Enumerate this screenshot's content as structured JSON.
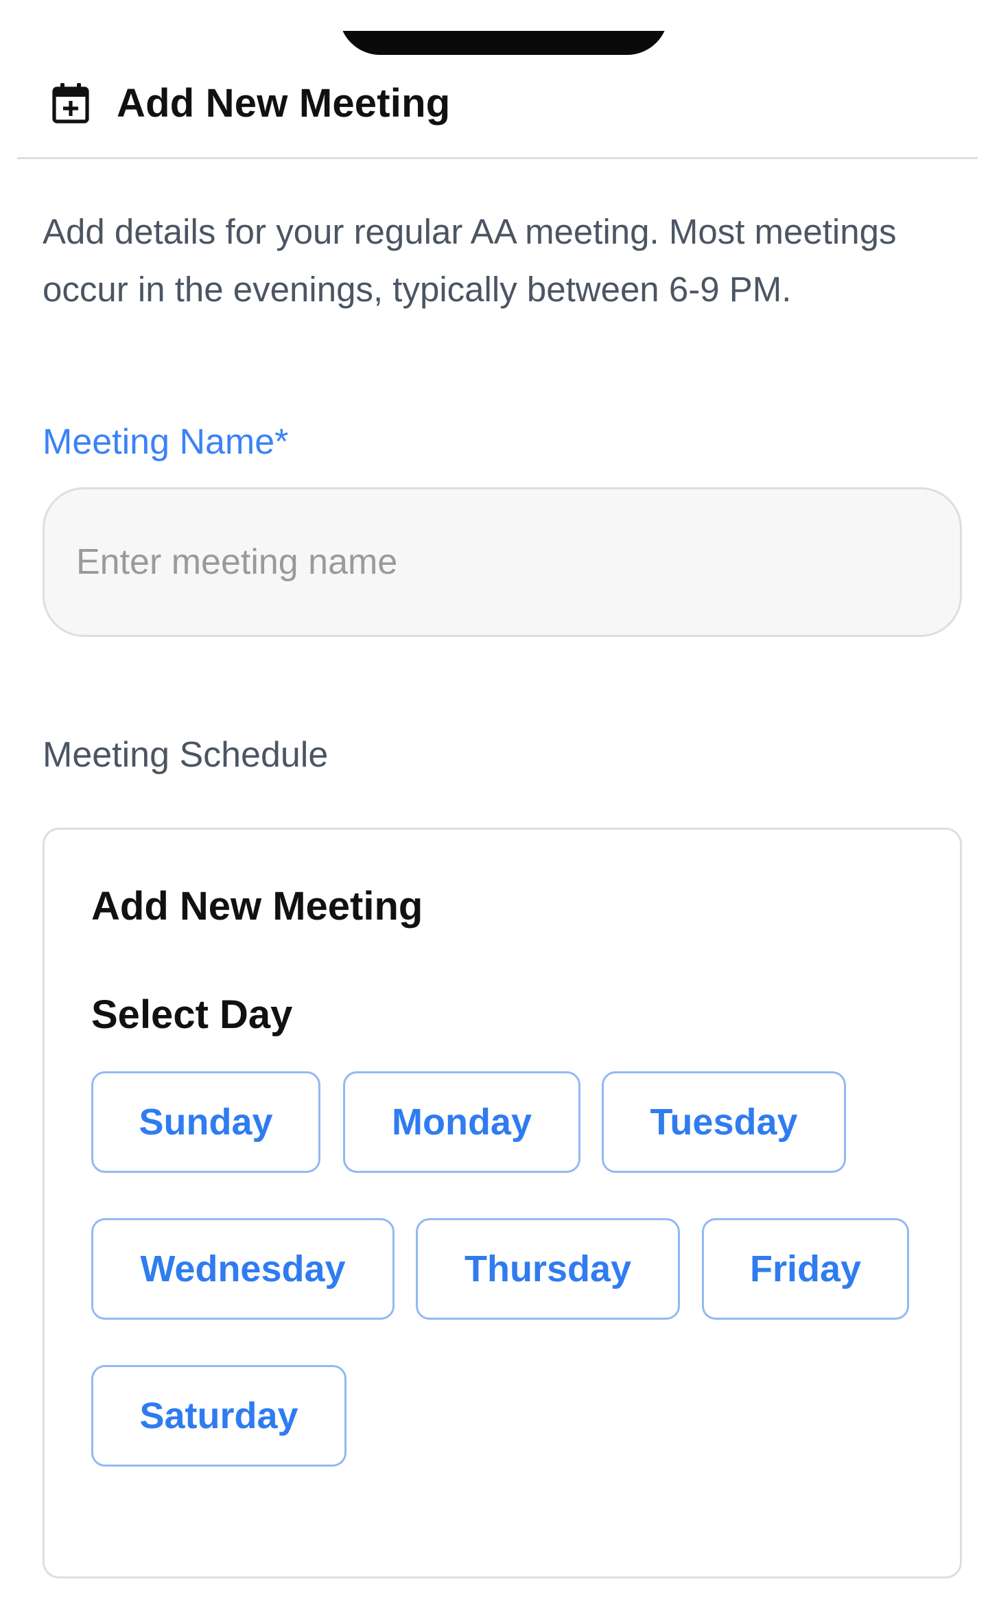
{
  "header": {
    "icon": "calendar-plus-icon",
    "title": "Add New Meeting"
  },
  "description": "Add details for your regular AA meeting. Most meetings occur in the evenings, typically between 6-9 PM.",
  "form": {
    "meeting_name": {
      "label": "Meeting Name*",
      "placeholder": "Enter meeting name",
      "value": ""
    },
    "schedule_label": "Meeting Schedule"
  },
  "schedule_card": {
    "title": "Add New Meeting",
    "select_day_label": "Select Day",
    "days": [
      "Sunday",
      "Monday",
      "Tuesday",
      "Wednesday",
      "Thursday",
      "Friday",
      "Saturday"
    ]
  },
  "colors": {
    "accent": "#3b82f6",
    "day_button_border": "#93b8f5",
    "day_button_text": "#2f7cf0",
    "muted_text": "#4b5563",
    "input_background": "#f7f7f7"
  }
}
